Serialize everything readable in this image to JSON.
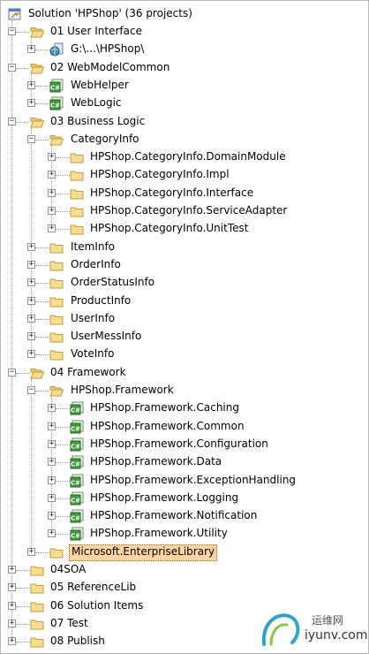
{
  "tree": {
    "solution": "Solution 'HPShop' (36 projects)",
    "nodes": [
      {
        "label": "01 User Interface",
        "icon": "folder-open-icon",
        "depth": 1,
        "expanded": true
      },
      {
        "label": "G:\\...\\HPShop\\",
        "icon": "website-globe-icon",
        "depth": 2,
        "expanded": false
      },
      {
        "label": "02 WebModelCommon",
        "icon": "folder-open-icon",
        "depth": 1,
        "expanded": true
      },
      {
        "label": "WebHelper",
        "icon": "csharp-project-icon",
        "depth": 2,
        "expanded": false
      },
      {
        "label": "WebLogic",
        "icon": "csharp-project-icon",
        "depth": 2,
        "expanded": false
      },
      {
        "label": "03 Business Logic",
        "icon": "folder-open-icon",
        "depth": 1,
        "expanded": true
      },
      {
        "label": "CategoryInfo",
        "icon": "folder-open-icon",
        "depth": 2,
        "expanded": true
      },
      {
        "label": "HPShop.CategoryInfo.DomainModule",
        "icon": "folder-icon",
        "depth": 3,
        "expanded": false
      },
      {
        "label": "HPShop.CategoryInfo.Impl",
        "icon": "folder-icon",
        "depth": 3,
        "expanded": false
      },
      {
        "label": "HPShop.CategoryInfo.Interface",
        "icon": "folder-icon",
        "depth": 3,
        "expanded": false
      },
      {
        "label": "HPShop.CategoryInfo.ServiceAdapter",
        "icon": "folder-icon",
        "depth": 3,
        "expanded": false
      },
      {
        "label": "HPShop.CategoryInfo.UnitTest",
        "icon": "folder-icon",
        "depth": 3,
        "expanded": false
      },
      {
        "label": "ItemInfo",
        "icon": "folder-icon",
        "depth": 2,
        "expanded": false
      },
      {
        "label": "OrderInfo",
        "icon": "folder-icon",
        "depth": 2,
        "expanded": false
      },
      {
        "label": "OrderStatusInfo",
        "icon": "folder-icon",
        "depth": 2,
        "expanded": false
      },
      {
        "label": "ProductInfo",
        "icon": "folder-icon",
        "depth": 2,
        "expanded": false
      },
      {
        "label": "UserInfo",
        "icon": "folder-icon",
        "depth": 2,
        "expanded": false
      },
      {
        "label": "UserMessInfo",
        "icon": "folder-icon",
        "depth": 2,
        "expanded": false
      },
      {
        "label": "VoteInfo",
        "icon": "folder-icon",
        "depth": 2,
        "expanded": false
      },
      {
        "label": "04 Framework",
        "icon": "folder-open-icon",
        "depth": 1,
        "expanded": true
      },
      {
        "label": "HPShop.Framework",
        "icon": "folder-open-icon",
        "depth": 2,
        "expanded": true
      },
      {
        "label": "HPShop.Framework.Caching",
        "icon": "csharp-project-icon",
        "depth": 3,
        "expanded": false
      },
      {
        "label": "HPShop.Framework.Common",
        "icon": "csharp-project-icon",
        "depth": 3,
        "expanded": false
      },
      {
        "label": "HPShop.Framework.Configuration",
        "icon": "csharp-project-icon",
        "depth": 3,
        "expanded": false
      },
      {
        "label": "HPShop.Framework.Data",
        "icon": "csharp-project-icon",
        "depth": 3,
        "expanded": false
      },
      {
        "label": "HPShop.Framework.ExceptionHandling",
        "icon": "csharp-project-icon",
        "depth": 3,
        "expanded": false
      },
      {
        "label": "HPShop.Framework.Logging",
        "icon": "csharp-project-icon",
        "depth": 3,
        "expanded": false
      },
      {
        "label": "HPShop.Framework.Notification",
        "icon": "csharp-project-icon",
        "depth": 3,
        "expanded": false
      },
      {
        "label": "HPShop.Framework.Utility",
        "icon": "csharp-project-icon",
        "depth": 3,
        "expanded": false
      },
      {
        "label": "Microsoft.EnterpriseLibrary",
        "icon": "folder-icon",
        "depth": 2,
        "expanded": false,
        "selected": true
      },
      {
        "label": "04SOA",
        "icon": "folder-icon",
        "depth": 1,
        "expanded": false
      },
      {
        "label": "05 ReferenceLib",
        "icon": "folder-icon",
        "depth": 1,
        "expanded": false
      },
      {
        "label": "06 Solution Items",
        "icon": "folder-icon",
        "depth": 1,
        "expanded": false
      },
      {
        "label": "07 Test",
        "icon": "folder-icon",
        "depth": 1,
        "expanded": false
      },
      {
        "label": "08 Publish",
        "icon": "folder-icon",
        "depth": 1,
        "expanded": false
      }
    ]
  },
  "watermark": {
    "cn": "运维网",
    "en": "iyunv.com"
  },
  "colors": {
    "selection_bg": "#fbd4a3",
    "folder_fill": "#f8dc8f",
    "folder_edge": "#c09a3b",
    "csharp_green": "#3f9a3c"
  }
}
